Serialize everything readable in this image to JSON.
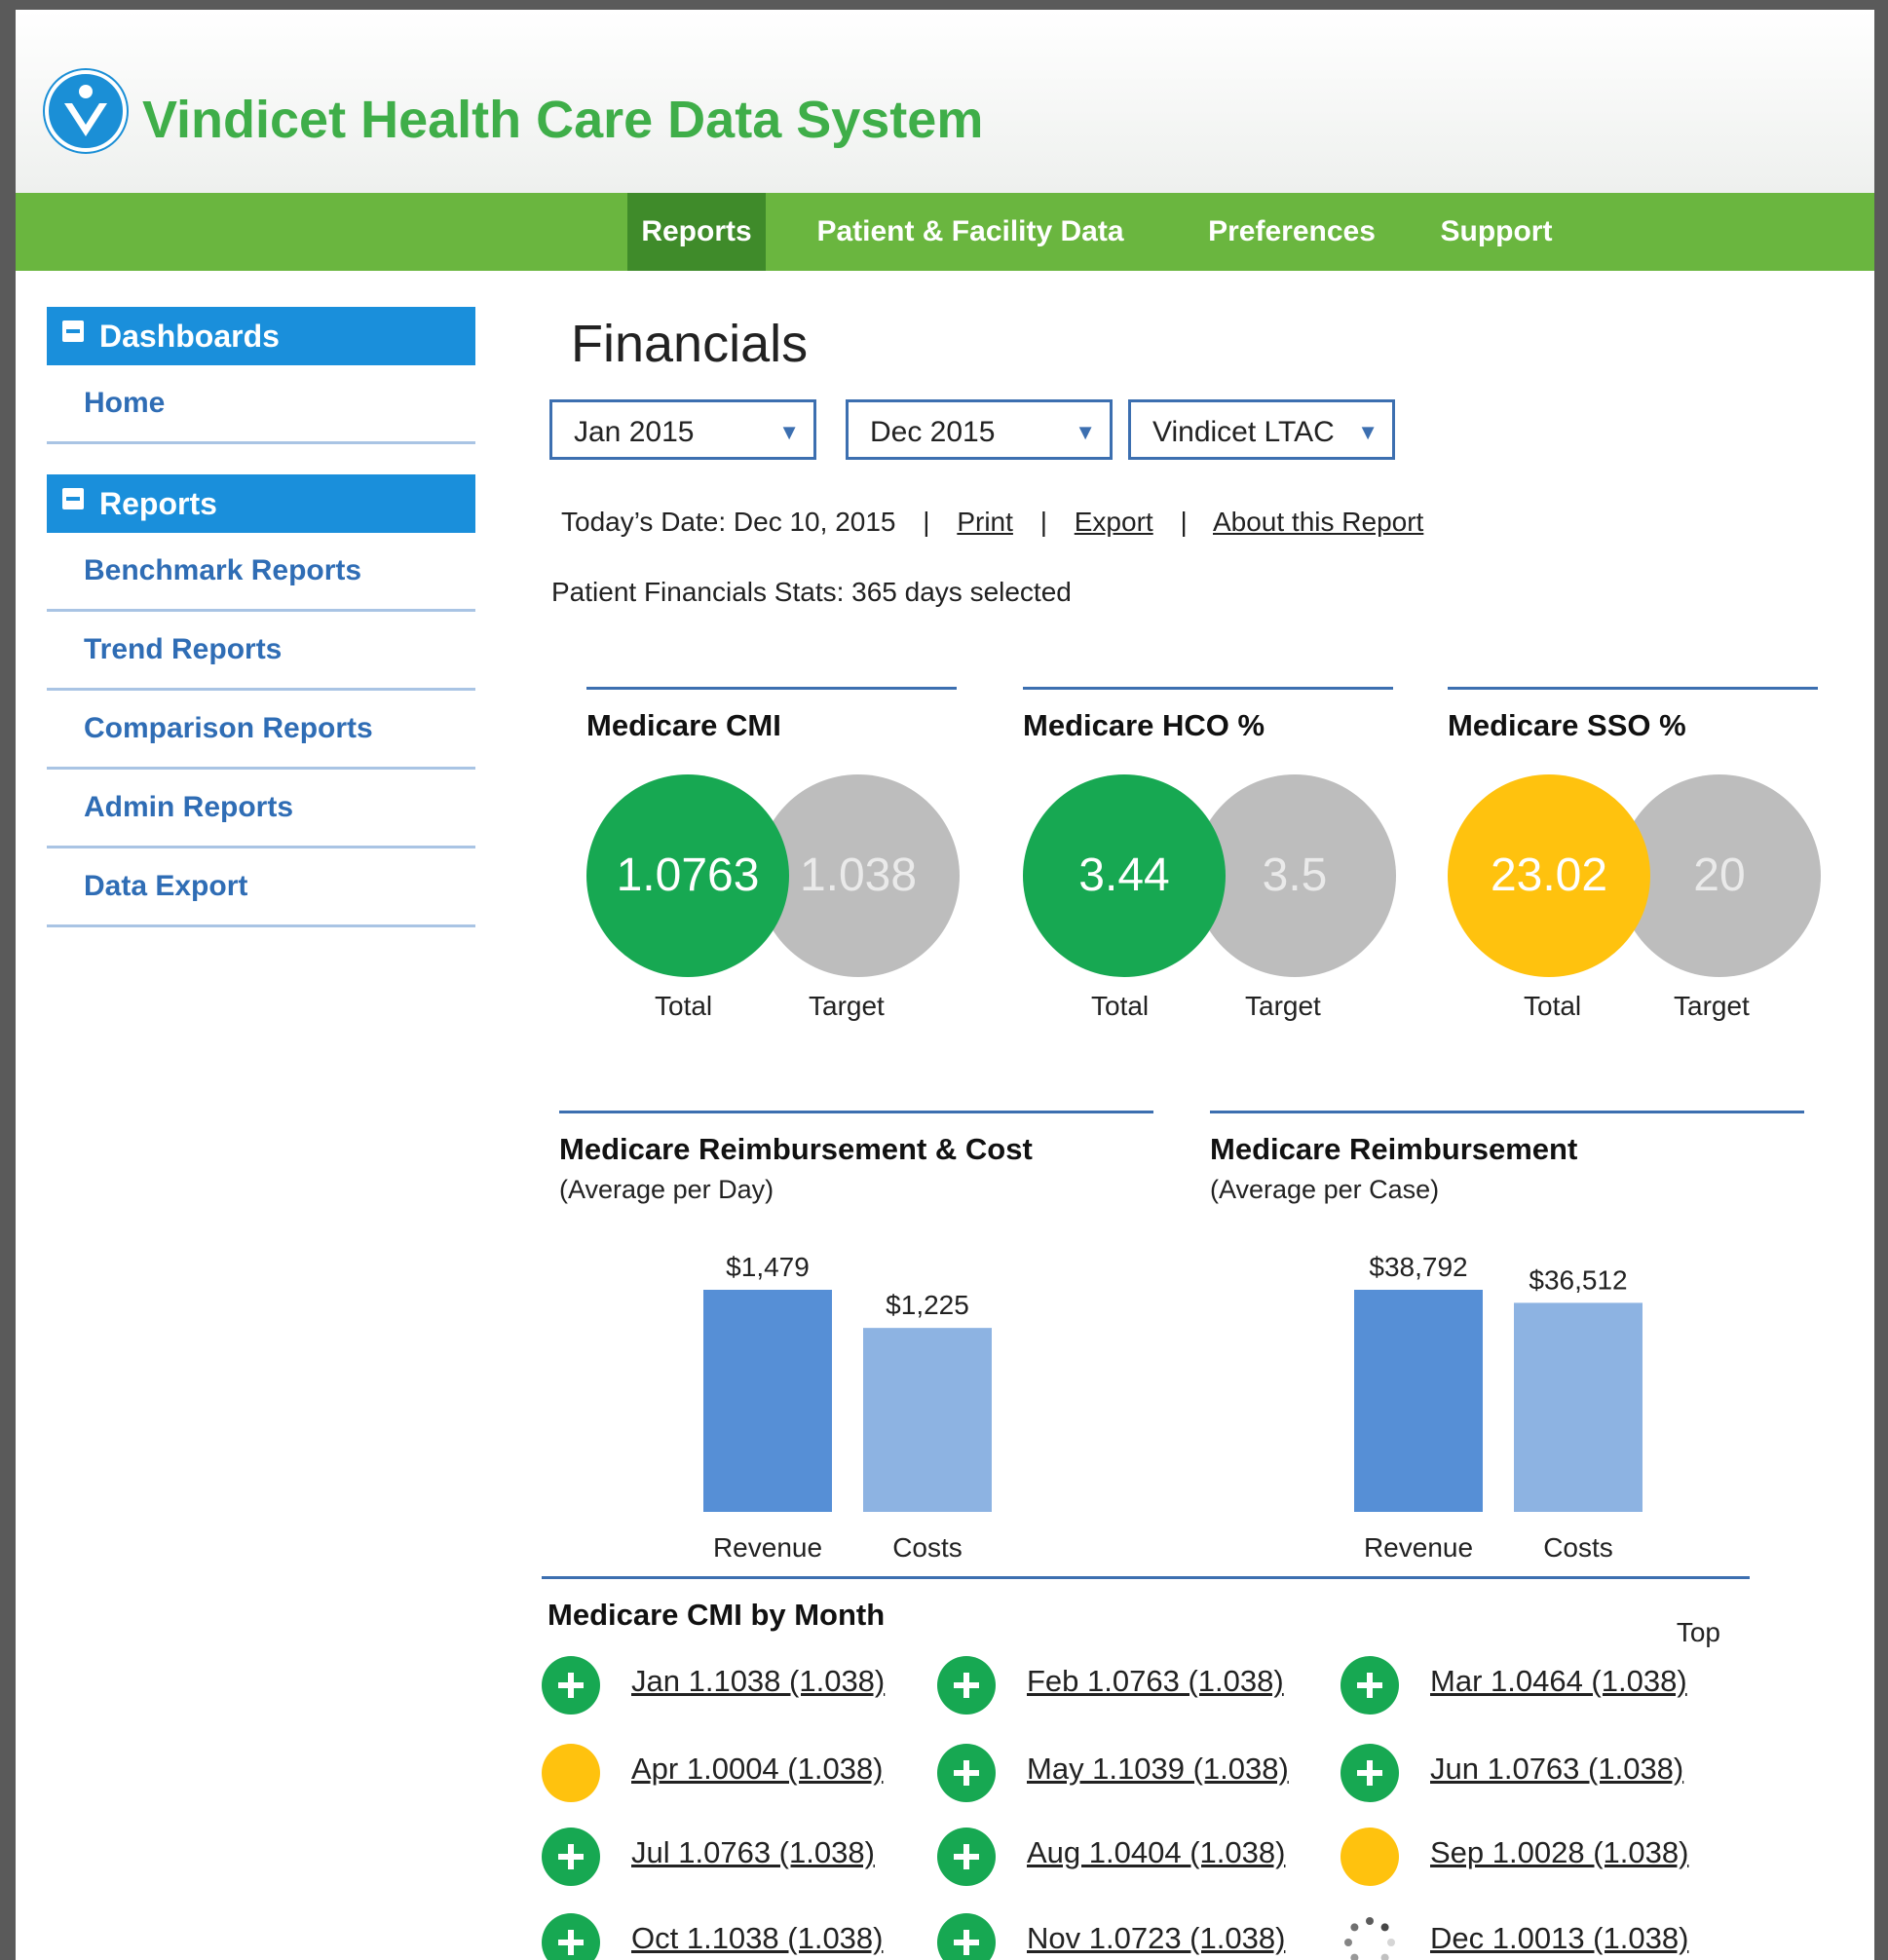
{
  "app": {
    "title": "Vindicet Health Care Data System",
    "logo_icon": "vindicet-v-logo"
  },
  "nav": [
    {
      "label": "Reports",
      "active": true
    },
    {
      "label": "Patient & Facility Data",
      "active": false
    },
    {
      "label": "Preferences",
      "active": false
    },
    {
      "label": "Support",
      "active": false
    }
  ],
  "sidebar": {
    "dashboards_header": "Dashboards",
    "dashboards_items": [
      "Home"
    ],
    "reports_header": "Reports",
    "reports_items": [
      "Benchmark Reports",
      "Trend Reports",
      "Comparison Reports",
      "Admin Reports",
      "Data Export"
    ]
  },
  "page": {
    "title": "Financials",
    "filters": {
      "start": "Jan 2015",
      "end": "Dec 2015",
      "facility": "Vindicet LTAC"
    },
    "toolbar": {
      "today": "Today’s Date: Dec 10, 2015",
      "print": "Print",
      "export": "Export",
      "about": "About this Report"
    },
    "stats": "Patient Financials  Stats: 365 days selected"
  },
  "kpis": [
    {
      "title": "Medicare CMI",
      "total": "1.0763",
      "target": "1.038",
      "total_label": "Total",
      "target_label": "Target",
      "status_color": "#17a852"
    },
    {
      "title": "Medicare HCO %",
      "total": "3.44",
      "target": "3.5",
      "total_label": "Total",
      "target_label": "Target",
      "status_color": "#17a852"
    },
    {
      "title": "Medicare SSO %",
      "total": "23.02",
      "target": "20",
      "total_label": "Total",
      "target_label": "Target",
      "status_color": "#ffc20e"
    }
  ],
  "chart_data": [
    {
      "type": "bar",
      "title": "Medicare Reimbursement & Cost",
      "subtitle": "(Average per Day)",
      "categories": [
        "Revenue",
        "Costs"
      ],
      "values": [
        1479,
        1225
      ],
      "value_labels": [
        "$1,479",
        "$1,225"
      ],
      "colors": [
        "#568fd6",
        "#8db3e2"
      ],
      "grid": false
    },
    {
      "type": "bar",
      "title": "Medicare Reimbursement",
      "subtitle": "(Average per Case)",
      "categories": [
        "Revenue",
        "Costs"
      ],
      "values": [
        38792,
        36512
      ],
      "value_labels": [
        "$38,792",
        "$36,512"
      ],
      "colors": [
        "#568fd6",
        "#8db3e2"
      ],
      "grid": false
    }
  ],
  "monthly": {
    "title": "Medicare CMI by Month",
    "top_link": "Top",
    "items": [
      {
        "text": "Jan 1.1038 (1.038)",
        "status": "green"
      },
      {
        "text": "Feb 1.0763 (1.038)",
        "status": "green"
      },
      {
        "text": "Mar  1.0464 (1.038)",
        "status": "green"
      },
      {
        "text": "Apr 1.0004 (1.038)",
        "status": "yellow"
      },
      {
        "text": "May 1.1039 (1.038)",
        "status": "green"
      },
      {
        "text": "Jun 1.0763 (1.038)",
        "status": "green"
      },
      {
        "text": "Jul  1.0763 (1.038)",
        "status": "green"
      },
      {
        "text": "Aug  1.0404  (1.038)",
        "status": "green"
      },
      {
        "text": "Sep 1.0028 (1.038)",
        "status": "yellow"
      },
      {
        "text": "Oct  1.1038 (1.038)",
        "status": "green"
      },
      {
        "text": "Nov 1.0723 (1.038)",
        "status": "green"
      },
      {
        "text": "Dec 1.0013 (1.038)",
        "status": "loading"
      }
    ]
  }
}
